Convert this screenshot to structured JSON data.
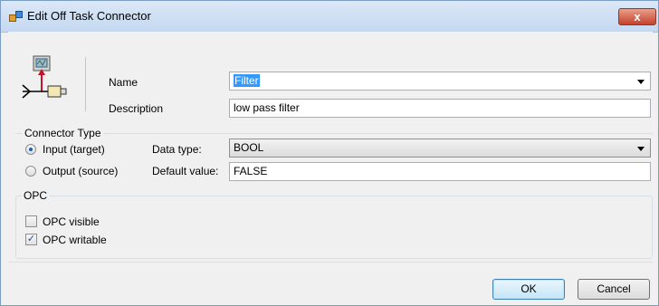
{
  "window": {
    "title": "Edit Off Task Connector",
    "close_label": "x"
  },
  "general": {
    "name_label": "Name",
    "name_value": "Filter",
    "description_label": "Description",
    "description_value": "low pass filter"
  },
  "connector_type": {
    "group_title": "Connector Type",
    "input_label": "Input (target)",
    "input_selected": true,
    "output_label": "Output (source)",
    "output_selected": false,
    "data_type_label": "Data type:",
    "data_type_value": "BOOL",
    "default_value_label": "Default value:",
    "default_value": "FALSE"
  },
  "opc": {
    "group_title": "OPC",
    "visible_label": "OPC visible",
    "visible_checked": false,
    "writable_label": "OPC writable",
    "writable_checked": true
  },
  "buttons": {
    "ok_label": "OK",
    "cancel_label": "Cancel"
  },
  "icons": {
    "app": "app-icon",
    "connector": "connector-icon",
    "dropdown": "chevron-down-icon",
    "close": "close-icon"
  },
  "colors": {
    "title_bar": "#c4d8f0",
    "close_button": "#c5412b",
    "selection": "#3399ff",
    "dialog_bg": "#f0f0f0"
  }
}
